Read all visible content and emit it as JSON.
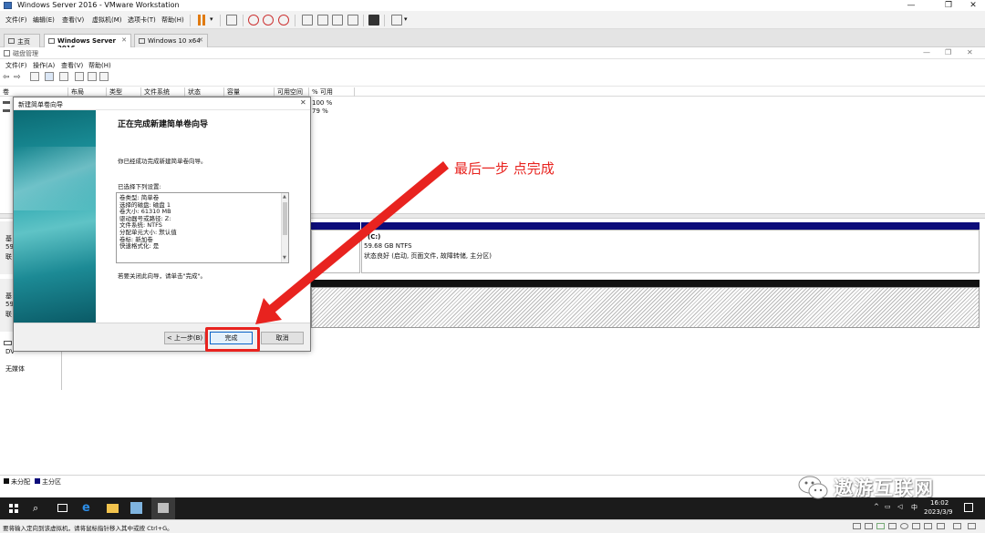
{
  "vm_window": {
    "title": "Windows Server 2016 - VMware Workstation",
    "menu": [
      "文件(F)",
      "编辑(E)",
      "查看(V)",
      "虚拟机(M)",
      "选项卡(T)",
      "帮助(H)"
    ]
  },
  "tabs": [
    {
      "label": "主页",
      "active": false
    },
    {
      "label": "Windows Server 2016",
      "active": true
    },
    {
      "label": "Windows 10 x64",
      "active": false
    }
  ],
  "disk_mgmt": {
    "title": "磁盘管理",
    "menu": [
      "文件(F)",
      "操作(A)",
      "查看(V)",
      "帮助(H)"
    ],
    "columns": [
      "卷",
      "布局",
      "类型",
      "文件系统",
      "状态",
      "容量",
      "可用空间",
      "% 可用"
    ],
    "volume_rows": [
      {
        "vol": "",
        "pct": "100 %"
      },
      {
        "vol": "",
        "pct": "79 %"
      }
    ],
    "disks": [
      {
        "label_1": "基",
        "label_2": "59",
        "label_3": "联"
      },
      {
        "label_1": "基",
        "label_2": "59",
        "label_3": "联"
      }
    ],
    "cdrom": {
      "label": "DV",
      "media": "无媒体"
    },
    "c_partition": {
      "name": "(C:)",
      "size": "59.68 GB NTFS",
      "status": "状态良好 (启动, 页面文件, 故障转储, 主分区)"
    },
    "legend": [
      {
        "label": "未分配",
        "color": "#111111"
      },
      {
        "label": "主分区",
        "color": "#0c0c7a"
      }
    ]
  },
  "wizard": {
    "window_title": "新建简单卷向导",
    "heading": "正在完成新建简单卷向导",
    "intro": "你已经成功完成新建简单卷向导。",
    "selected_label": "已选择下列设置:",
    "settings": [
      "卷类型: 简单卷",
      "选择的磁盘: 磁盘 1",
      "卷大小: 61310 MB",
      "驱动器号或路径: Z:",
      "文件系统: NTFS",
      "分配单元大小: 默认值",
      "卷标: 新加卷",
      "快速格式化: 是"
    ],
    "close_hint": "若要关闭此向导，请单击\"完成\"。",
    "buttons": {
      "back": "< 上一步(B)",
      "finish": "完成",
      "cancel": "取消"
    }
  },
  "annotation": {
    "text": "最后一步 点完成",
    "color": "#e8231f"
  },
  "taskbar": {
    "ime": "中",
    "time": "16:02",
    "date": "2023/3/9"
  },
  "status_bar": {
    "text": "要将输入定向到该虚拟机，请将鼠标指针移入其中或按 Ctrl+G。"
  },
  "watermark": {
    "text": "遨游互联网"
  }
}
